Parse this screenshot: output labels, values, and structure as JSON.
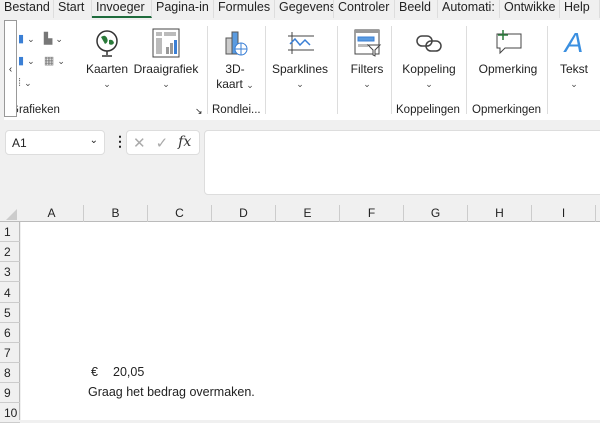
{
  "tabs": [
    "Bestand",
    "Start",
    "Invoeger",
    "Pagina-in",
    "Formules",
    "Gegevens",
    "Controler",
    "Beeld",
    "Automati:",
    "Ontwikke",
    "Help"
  ],
  "active_tab": "Invoeger",
  "ribbon": {
    "kaarten": "Kaarten",
    "draaigrafiek": "Draaigrafiek",
    "kaart3d_1": "3D-",
    "kaart3d_2": "kaart",
    "sparklines": "Sparklines",
    "filters": "Filters",
    "koppeling": "Koppeling",
    "opmerking": "Opmerking",
    "tekst": "Tekst",
    "groups": {
      "grafieken": "Grafieken",
      "rondleidingen": "Rondlei...",
      "koppelingen": "Koppelingen",
      "opmerkingen": "Opmerkingen"
    }
  },
  "namebox": "A1",
  "formula": "",
  "columns": [
    "A",
    "B",
    "C",
    "D",
    "E",
    "F",
    "G",
    "H",
    "I"
  ],
  "rows": [
    "1",
    "2",
    "3",
    "4",
    "5",
    "6",
    "7",
    "8",
    "9",
    "10"
  ],
  "cells": {
    "B8_symbol": "€",
    "B8_value": "20,05",
    "B9": "Graag het bedrag overmaken."
  }
}
